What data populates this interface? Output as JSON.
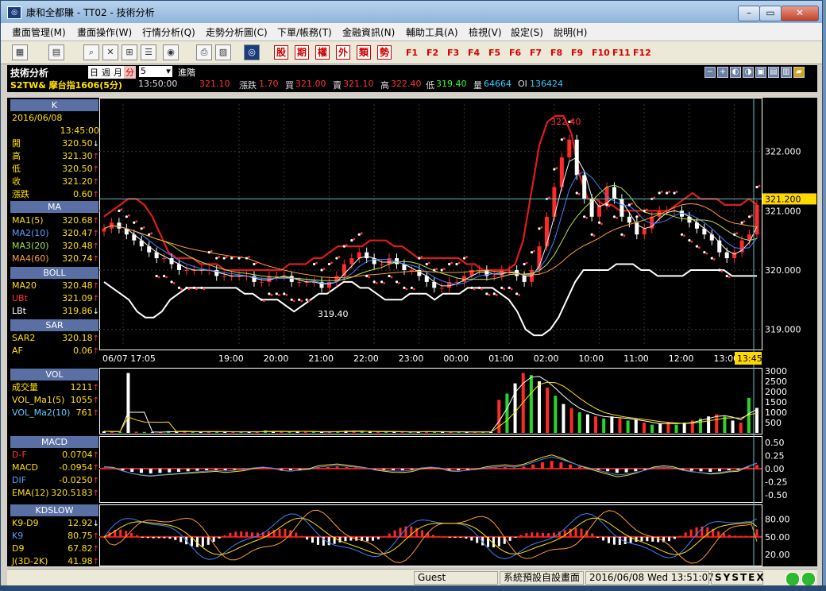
{
  "window": {
    "title": "康和全都賺 - TT02 - 技術分析",
    "app_icon": "app-logo-icon",
    "min": "–",
    "max": "▭",
    "close": "✕"
  },
  "menu": [
    "畫面管理(M)",
    "畫面操作(W)",
    "行情分析(Q)",
    "走勢分析圖(C)",
    "下單/帳務(T)",
    "金融資訊(N)",
    "輔助工具(A)",
    "檢視(V)",
    "設定(S)",
    "說明(H)"
  ],
  "toolbar": {
    "quick": [
      "股",
      "期",
      "權",
      "外",
      "類",
      "勢"
    ],
    "fkeys": [
      "F1",
      "F2",
      "F3",
      "F4",
      "F5",
      "F6",
      "F7",
      "F8",
      "F9",
      "F10",
      "F11",
      "F12"
    ]
  },
  "infobar": {
    "title": "技術分析",
    "period_day": "日",
    "period_week": "週",
    "period_month": "月",
    "period_min": "分",
    "interval": "5",
    "advanced": "進階",
    "symbol": "S2TW& 摩台指1606(5分)",
    "time": "13:50:00",
    "price": "321.10",
    "change_label": "漲跌",
    "change": "1.70",
    "bid_label": "買",
    "bid": "321.00",
    "ask_label": "賣",
    "ask": "321.10",
    "high_label": "高",
    "high": "322.40",
    "low_label": "低",
    "low": "319.40",
    "vol_label": "量",
    "vol": "64664",
    "oi_label": "OI",
    "oi": "136424"
  },
  "panel": {
    "k": {
      "title": "K",
      "date": "2016/06/08",
      "time": "13:45:00",
      "rows": [
        {
          "k": "開",
          "v": "320.50",
          "a": "↓"
        },
        {
          "k": "高",
          "v": "321.30",
          "a": "↑"
        },
        {
          "k": "低",
          "v": "320.50",
          "a": "↑"
        },
        {
          "k": "收",
          "v": "321.20",
          "a": "↑"
        },
        {
          "k": "漲跌",
          "v": "0.60",
          "a": "↑"
        }
      ]
    },
    "ma": {
      "title": "MA",
      "rows": [
        {
          "k": "MA1(5)",
          "v": "320.68",
          "a": "↑"
        },
        {
          "k": "MA2(10)",
          "v": "320.47",
          "a": "↑"
        },
        {
          "k": "MA3(20)",
          "v": "320.48",
          "a": "↑"
        },
        {
          "k": "MA4(60)",
          "v": "320.74",
          "a": "↑"
        }
      ]
    },
    "boll": {
      "title": "BOLL",
      "rows": [
        {
          "k": "MA20",
          "v": "320.48",
          "a": "↑"
        },
        {
          "k": "UBt",
          "v": "321.09",
          "a": "↑"
        },
        {
          "k": "LBt",
          "v": "319.86",
          "a": "↓"
        }
      ]
    },
    "sar": {
      "title": "SAR",
      "rows": [
        {
          "k": "SAR2",
          "v": "320.18",
          "a": "↑"
        },
        {
          "k": "AF",
          "v": "0.06",
          "a": "↑"
        }
      ]
    },
    "vol": {
      "title": "VOL",
      "rows": [
        {
          "k": "成交量",
          "v": "1211",
          "a": "↑"
        },
        {
          "k": "VOL_Ma1(5)",
          "v": "1055",
          "a": "↑"
        },
        {
          "k": "VOL_Ma2(10)",
          "v": "761",
          "a": "↑"
        }
      ]
    },
    "macd": {
      "title": "MACD",
      "rows": [
        {
          "k": "D-F",
          "v": "0.0704",
          "a": "↑"
        },
        {
          "k": "MACD",
          "v": "-0.0954",
          "a": "↑"
        },
        {
          "k": "DIF",
          "v": "-0.0250",
          "a": "↑"
        },
        {
          "k": "EMA(12)",
          "v": "320.5183",
          "a": "↑"
        }
      ]
    },
    "kd": {
      "title": "KDSLOW",
      "rows": [
        {
          "k": "K9-D9",
          "v": "12.92",
          "a": "↓"
        },
        {
          "k": "K9",
          "v": "80.75",
          "a": "↑"
        },
        {
          "k": "D9",
          "v": "67.82",
          "a": "↑"
        },
        {
          "k": "J(3D-2K)",
          "v": "41.98",
          "a": "↑"
        }
      ]
    }
  },
  "chart_data": {
    "type": "candlestick",
    "price_axis": {
      "ticks": [
        "322.000",
        "321.000",
        "320.000",
        "319.000"
      ],
      "ylim": [
        318.7,
        322.8
      ],
      "cursor_label": "321.200"
    },
    "time_axis": [
      "06/07 17:05",
      "19:00",
      "20:00",
      "21:00",
      "22:00",
      "23:00",
      "00:00",
      "01:00",
      "02:00",
      "10:00",
      "11:00",
      "12:00",
      "13:00"
    ],
    "cursor_time": "13:45",
    "annotations": [
      {
        "text": "322.40",
        "value": 322.4
      },
      {
        "text": "319.40",
        "value": 319.4
      }
    ],
    "close": [
      320.7,
      320.8,
      320.7,
      320.6,
      320.5,
      320.4,
      320.3,
      320.2,
      320.2,
      320.1,
      320.0,
      320.0,
      320.0,
      320.0,
      320.0,
      319.9,
      319.9,
      319.9,
      319.9,
      319.9,
      319.8,
      319.8,
      319.9,
      319.9,
      319.9,
      319.8,
      319.8,
      319.8,
      319.8,
      319.7,
      319.8,
      319.9,
      320.1,
      320.2,
      320.3,
      320.2,
      320.1,
      320.1,
      320.2,
      320.1,
      320.0,
      320.0,
      319.9,
      319.8,
      319.7,
      319.7,
      319.8,
      319.8,
      319.9,
      320.0,
      320.0,
      319.9,
      319.9,
      320.0,
      320.0,
      319.9,
      319.8,
      320.0,
      320.4,
      320.9,
      321.4,
      321.9,
      322.2,
      321.6,
      321.2,
      320.9,
      321.1,
      321.4,
      321.2,
      320.9,
      320.8,
      320.6,
      320.7,
      320.9,
      321.0,
      321.0,
      321.0,
      320.9,
      320.8,
      320.7,
      320.6,
      320.5,
      320.3,
      320.2,
      320.3,
      320.5,
      320.6,
      321.1
    ],
    "bb_upper": [
      320.9,
      321.0,
      321.1,
      321.2,
      321.2,
      321.1,
      320.9,
      320.6,
      320.3,
      320.2,
      320.2,
      320.2,
      320.1,
      320.1,
      320.1,
      320.0,
      320.0,
      320.0,
      320.0,
      320.0,
      320.0,
      320.0,
      320.0,
      320.1,
      320.1,
      320.1,
      320.2,
      320.2,
      320.3,
      320.4,
      320.4,
      320.4,
      320.4,
      320.5,
      320.5,
      320.5,
      320.4,
      320.4,
      320.3,
      320.2,
      320.2,
      320.2,
      320.2,
      320.2,
      320.2,
      320.1,
      320.1,
      320.0,
      320.0,
      320.0,
      320.0,
      320.1,
      320.5,
      321.3,
      322.1,
      322.5,
      322.6,
      322.6,
      322.3,
      321.6,
      321.2,
      321.2,
      321.1,
      321.1,
      321.0,
      321.0,
      321.0,
      321.0,
      321.0,
      321.0,
      321.0,
      321.1,
      321.2,
      321.3,
      321.2,
      321.2,
      321.2,
      321.1,
      321.1,
      321.1,
      321.2,
      321.1
    ],
    "bb_lower": [
      319.8,
      319.7,
      319.6,
      319.5,
      319.3,
      319.2,
      319.2,
      319.3,
      319.5,
      319.6,
      319.7,
      319.7,
      319.7,
      319.7,
      319.7,
      319.7,
      319.7,
      319.6,
      319.6,
      319.5,
      319.5,
      319.5,
      319.4,
      319.3,
      319.4,
      319.5,
      319.6,
      319.6,
      319.7,
      319.8,
      319.8,
      319.7,
      319.7,
      319.6,
      319.5,
      319.5,
      319.5,
      319.6,
      319.6,
      319.6,
      319.5,
      319.6,
      319.6,
      319.6,
      319.7,
      319.7,
      319.7,
      319.7,
      319.6,
      319.5,
      319.3,
      319.0,
      318.9,
      318.9,
      319.0,
      319.2,
      319.5,
      319.8,
      320.0,
      320.0,
      320.0,
      320.0,
      320.1,
      320.1,
      320.1,
      320.0,
      320.0,
      319.9,
      319.9,
      319.9,
      319.9,
      320.0,
      320.0,
      320.0,
      320.0,
      320.0,
      319.9,
      319.9,
      319.9,
      319.9
    ],
    "volume_axis": [
      "3000",
      "2500",
      "2000",
      "1500",
      "1000",
      "500"
    ],
    "volume": [
      80,
      60,
      40,
      2900,
      60,
      50,
      30,
      40,
      90,
      80,
      70,
      60,
      40,
      60,
      80,
      50,
      40,
      70,
      50,
      40,
      120,
      60,
      50,
      80,
      90,
      60,
      50,
      40,
      60,
      80,
      100,
      90,
      70,
      60,
      50,
      80,
      60,
      40,
      50,
      60,
      70,
      50,
      60,
      40,
      60,
      50,
      40,
      60,
      40,
      1600,
      1900,
      2400,
      2900,
      2800,
      2500,
      2200,
      1800,
      1400,
      1200,
      1000,
      900,
      800,
      700,
      800,
      700,
      600,
      650,
      500,
      400,
      450,
      500,
      400,
      500,
      600,
      700,
      800,
      900,
      800,
      600,
      500,
      1700,
      1211
    ],
    "macd_axis": [
      "0.50",
      "0.25",
      "0.00",
      "-0.25",
      "-0.50"
    ],
    "macd_hist": [
      0.02,
      0.01,
      -0.03,
      -0.06,
      -0.08,
      -0.09,
      -0.08,
      -0.07,
      -0.06,
      -0.05,
      -0.04,
      -0.03,
      -0.02,
      -0.03,
      -0.02,
      -0.01,
      0.01,
      0.02,
      0.01,
      -0.02,
      -0.03,
      -0.02,
      -0.01,
      0.02,
      0.03,
      0.04,
      0.03,
      0.02,
      0.01,
      -0.01,
      -0.02,
      -0.03,
      -0.03,
      -0.02,
      0.01,
      0.02,
      0.01,
      -0.02,
      -0.03,
      -0.02,
      -0.01,
      0.01,
      0.02,
      0.03,
      0.02,
      0.04,
      0.08,
      0.12,
      0.15,
      0.12,
      0.08,
      0.04,
      0.01,
      -0.02,
      -0.05,
      -0.08,
      -0.07,
      -0.05,
      -0.02,
      0.01,
      0.02,
      0.01,
      -0.02,
      -0.04,
      -0.05,
      -0.06,
      -0.05,
      -0.03,
      -0.02,
      0.03,
      0.07
    ],
    "kd_axis": [
      "80.00",
      "50.00",
      "20.00"
    ],
    "k9_last": 80.75,
    "d9_last": 67.82
  },
  "status": {
    "user": "Guest",
    "layout": "系統預設自設畫面",
    "datetime": "2016/06/08 Wed 13:51:07",
    "brand": "SYSTEX"
  }
}
